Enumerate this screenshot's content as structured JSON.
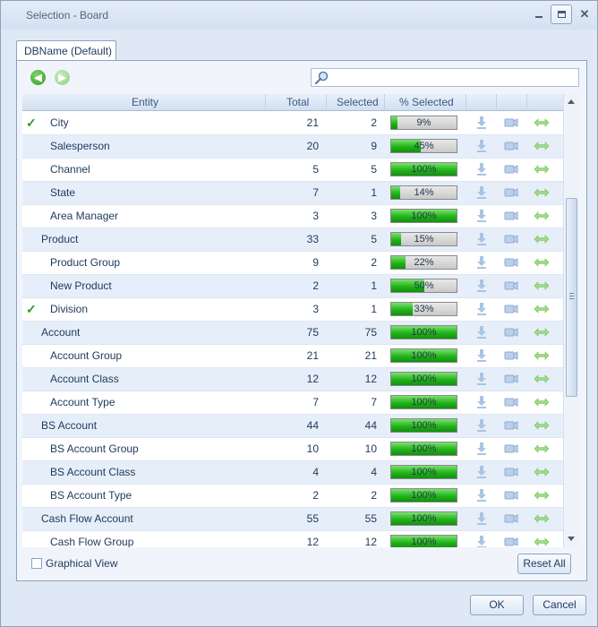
{
  "window": {
    "title": "Selection - Board"
  },
  "tab": {
    "label": "DBName (Default)"
  },
  "search": {
    "placeholder": "",
    "value": ""
  },
  "grid": {
    "columns": [
      "Entity",
      "Total",
      "Selected",
      "% Selected"
    ],
    "rows": [
      {
        "entity": "City",
        "total": "21",
        "selected": "2",
        "percent_text": "9%",
        "percent": 9,
        "checked": true,
        "indent": 1,
        "alt": false
      },
      {
        "entity": "Salesperson",
        "total": "20",
        "selected": "9",
        "percent_text": "45%",
        "percent": 45,
        "checked": false,
        "indent": 1,
        "alt": true
      },
      {
        "entity": "Channel",
        "total": "5",
        "selected": "5",
        "percent_text": "100%",
        "percent": 100,
        "checked": false,
        "indent": 1,
        "alt": false
      },
      {
        "entity": "State",
        "total": "7",
        "selected": "1",
        "percent_text": "14%",
        "percent": 14,
        "checked": false,
        "indent": 1,
        "alt": true
      },
      {
        "entity": "Area Manager",
        "total": "3",
        "selected": "3",
        "percent_text": "100%",
        "percent": 100,
        "checked": false,
        "indent": 1,
        "alt": false
      },
      {
        "entity": "Product",
        "total": "33",
        "selected": "5",
        "percent_text": "15%",
        "percent": 15,
        "checked": false,
        "indent": 0,
        "alt": true
      },
      {
        "entity": "Product Group",
        "total": "9",
        "selected": "2",
        "percent_text": "22%",
        "percent": 22,
        "checked": false,
        "indent": 1,
        "alt": false
      },
      {
        "entity": "New Product",
        "total": "2",
        "selected": "1",
        "percent_text": "50%",
        "percent": 50,
        "checked": false,
        "indent": 1,
        "alt": true
      },
      {
        "entity": "Division",
        "total": "3",
        "selected": "1",
        "percent_text": "33%",
        "percent": 33,
        "checked": true,
        "indent": 1,
        "alt": false
      },
      {
        "entity": "Account",
        "total": "75",
        "selected": "75",
        "percent_text": "100%",
        "percent": 100,
        "checked": false,
        "indent": 0,
        "alt": true
      },
      {
        "entity": "Account Group",
        "total": "21",
        "selected": "21",
        "percent_text": "100%",
        "percent": 100,
        "checked": false,
        "indent": 1,
        "alt": false
      },
      {
        "entity": "Account Class",
        "total": "12",
        "selected": "12",
        "percent_text": "100%",
        "percent": 100,
        "checked": false,
        "indent": 1,
        "alt": true
      },
      {
        "entity": "Account Type",
        "total": "7",
        "selected": "7",
        "percent_text": "100%",
        "percent": 100,
        "checked": false,
        "indent": 1,
        "alt": false
      },
      {
        "entity": "BS Account",
        "total": "44",
        "selected": "44",
        "percent_text": "100%",
        "percent": 100,
        "checked": false,
        "indent": 0,
        "alt": true
      },
      {
        "entity": "BS Account Group",
        "total": "10",
        "selected": "10",
        "percent_text": "100%",
        "percent": 100,
        "checked": false,
        "indent": 1,
        "alt": false
      },
      {
        "entity": "BS Account Class",
        "total": "4",
        "selected": "4",
        "percent_text": "100%",
        "percent": 100,
        "checked": false,
        "indent": 1,
        "alt": true
      },
      {
        "entity": "BS Account Type",
        "total": "2",
        "selected": "2",
        "percent_text": "100%",
        "percent": 100,
        "checked": false,
        "indent": 1,
        "alt": false
      },
      {
        "entity": "Cash Flow Account",
        "total": "55",
        "selected": "55",
        "percent_text": "100%",
        "percent": 100,
        "checked": false,
        "indent": 0,
        "alt": true
      },
      {
        "entity": "Cash Flow Group",
        "total": "12",
        "selected": "12",
        "percent_text": "100%",
        "percent": 100,
        "checked": false,
        "indent": 1,
        "alt": false
      }
    ]
  },
  "footer": {
    "graphical_view_label": "Graphical View",
    "graphical_view_checked": false,
    "reset_label": "Reset All",
    "ok_label": "OK",
    "cancel_label": "Cancel"
  },
  "colors": {
    "progress_fill": "#21b51a",
    "check_mark": "#2a9a28",
    "alt_row": "#e6eef9"
  }
}
